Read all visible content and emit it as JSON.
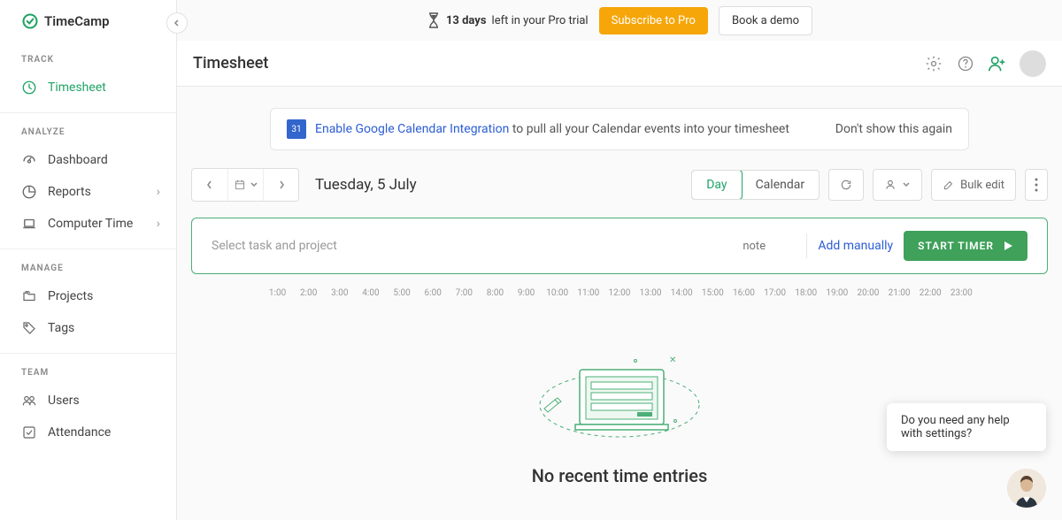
{
  "brand": "TimeCamp",
  "sidebar": {
    "track": {
      "header": "TRACK",
      "items": [
        {
          "label": "Timesheet"
        }
      ]
    },
    "analyze": {
      "header": "ANALYZE",
      "items": [
        {
          "label": "Dashboard"
        },
        {
          "label": "Reports"
        },
        {
          "label": "Computer Time"
        }
      ]
    },
    "manage": {
      "header": "MANAGE",
      "items": [
        {
          "label": "Projects"
        },
        {
          "label": "Tags"
        }
      ]
    },
    "team": {
      "header": "TEAM",
      "items": [
        {
          "label": "Users"
        },
        {
          "label": "Attendance"
        }
      ]
    }
  },
  "trial": {
    "days": "13 days",
    "rest": "left in your Pro trial",
    "subscribe": "Subscribe to Pro",
    "demo": "Book a demo"
  },
  "page_title": "Timesheet",
  "banner": {
    "cal_day": "31",
    "link": "Enable Google Calendar Integration",
    "text": " to pull all your Calendar events into your timesheet",
    "dismiss": "Don't show this again"
  },
  "date": "Tuesday, 5 July",
  "view": {
    "day": "Day",
    "calendar": "Calendar"
  },
  "bulk": "Bulk edit",
  "entry": {
    "task_placeholder": "Select task and project",
    "note_placeholder": "note",
    "add_manual": "Add manually",
    "start": "START TIMER"
  },
  "timeline_hours": [
    "1:00",
    "2:00",
    "3:00",
    "4:00",
    "5:00",
    "6:00",
    "7:00",
    "8:00",
    "9:00",
    "10:00",
    "11:00",
    "12:00",
    "13:00",
    "14:00",
    "15:00",
    "16:00",
    "17:00",
    "18:00",
    "19:00",
    "20:00",
    "21:00",
    "22:00",
    "23:00"
  ],
  "empty_title": "No recent time entries",
  "help": "Do you need any help with settings?"
}
